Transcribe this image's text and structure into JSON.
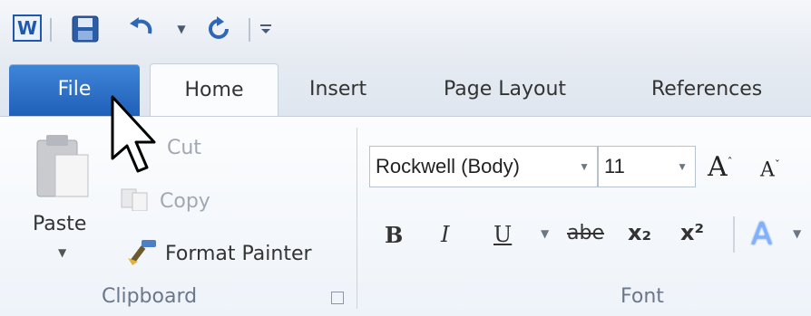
{
  "app": {
    "icon_letter": "W"
  },
  "tabs": {
    "file": "File",
    "home": "Home",
    "insert": "Insert",
    "page_layout": "Page Layout",
    "references": "References"
  },
  "clipboard": {
    "paste": "Paste",
    "cut": "Cut",
    "copy": "Copy",
    "format_painter": "Format Painter",
    "group_label": "Clipboard"
  },
  "font": {
    "font_name": "Rockwell (Body)",
    "font_size": "11",
    "group_label": "Font",
    "bold": "B",
    "italic": "I",
    "underline": "U",
    "strikethrough": "abe",
    "subscript": "x₂",
    "superscript": "x²"
  },
  "icons": {
    "save": "save-icon",
    "undo": "undo-icon",
    "redo": "redo-icon",
    "customize": "customize-qat-icon",
    "grow_font": "grow-font-icon",
    "shrink_font": "shrink-font-icon",
    "text_effects": "text-effects-icon",
    "cursor": "pointer-cursor-icon"
  },
  "colors": {
    "file_tab": "#1f5fb8",
    "accent_blue": "#1e58b0"
  }
}
